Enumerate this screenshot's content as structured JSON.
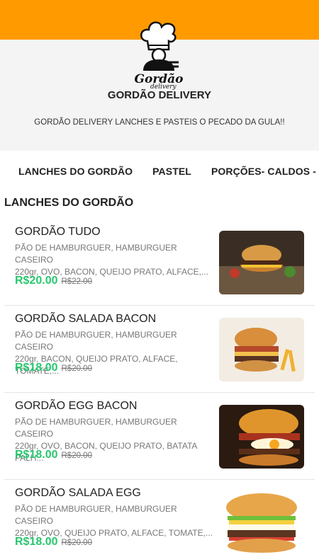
{
  "store": {
    "logo_text": "Gordão",
    "logo_sub": "delivery",
    "name": "GORDÃO DELIVERY",
    "description": "GORDÃO DELIVERY LANCHES E PASTEIS O PECADO DA GULA!!"
  },
  "tabs": [
    {
      "label": "LANCHES DO GORDÃO"
    },
    {
      "label": "PASTEL"
    },
    {
      "label": "PORÇÕES- CALDOS - M"
    }
  ],
  "section": {
    "title": "LANCHES DO GORDÃO"
  },
  "items": [
    {
      "name": "GORDÃO TUDO",
      "desc1": "PÃO DE HAMBURGUER, HAMBURGUER CASEIRO",
      "desc2": "220gr, OVO, BACON, QUEIJO PRATO, ALFACE,...",
      "price": "R$20.00",
      "old_price": "R$22.00"
    },
    {
      "name": "GORDÃO SALADA BACON",
      "desc1": "PÃO DE HAMBURGUER, HAMBURGUER CASEIRO",
      "desc2": "220gr, BACON, QUEIJO PRATO, ALFACE, TOMATE,...",
      "price": "R$18.00",
      "old_price": "R$20.00"
    },
    {
      "name": "GORDÃO EGG BACON",
      "desc1": "PÃO DE HAMBURGUER, HAMBURGUER CASEIRO",
      "desc2": "220gr, OVO, BACON, QUEIJO PRATO, BATATA PALH...",
      "price": "R$18.00",
      "old_price": "R$20.00"
    },
    {
      "name": "GORDÃO SALADA EGG",
      "desc1": "PÃO DE HAMBURGUER, HAMBURGUER CASEIRO",
      "desc2": "220gr, OVO, QUEIJO PRATO, ALFACE, TOMATE,...",
      "price": "R$18.00",
      "old_price": "R$20.00"
    }
  ],
  "colors": {
    "header": "#ff9a00",
    "price": "#28c76f"
  }
}
